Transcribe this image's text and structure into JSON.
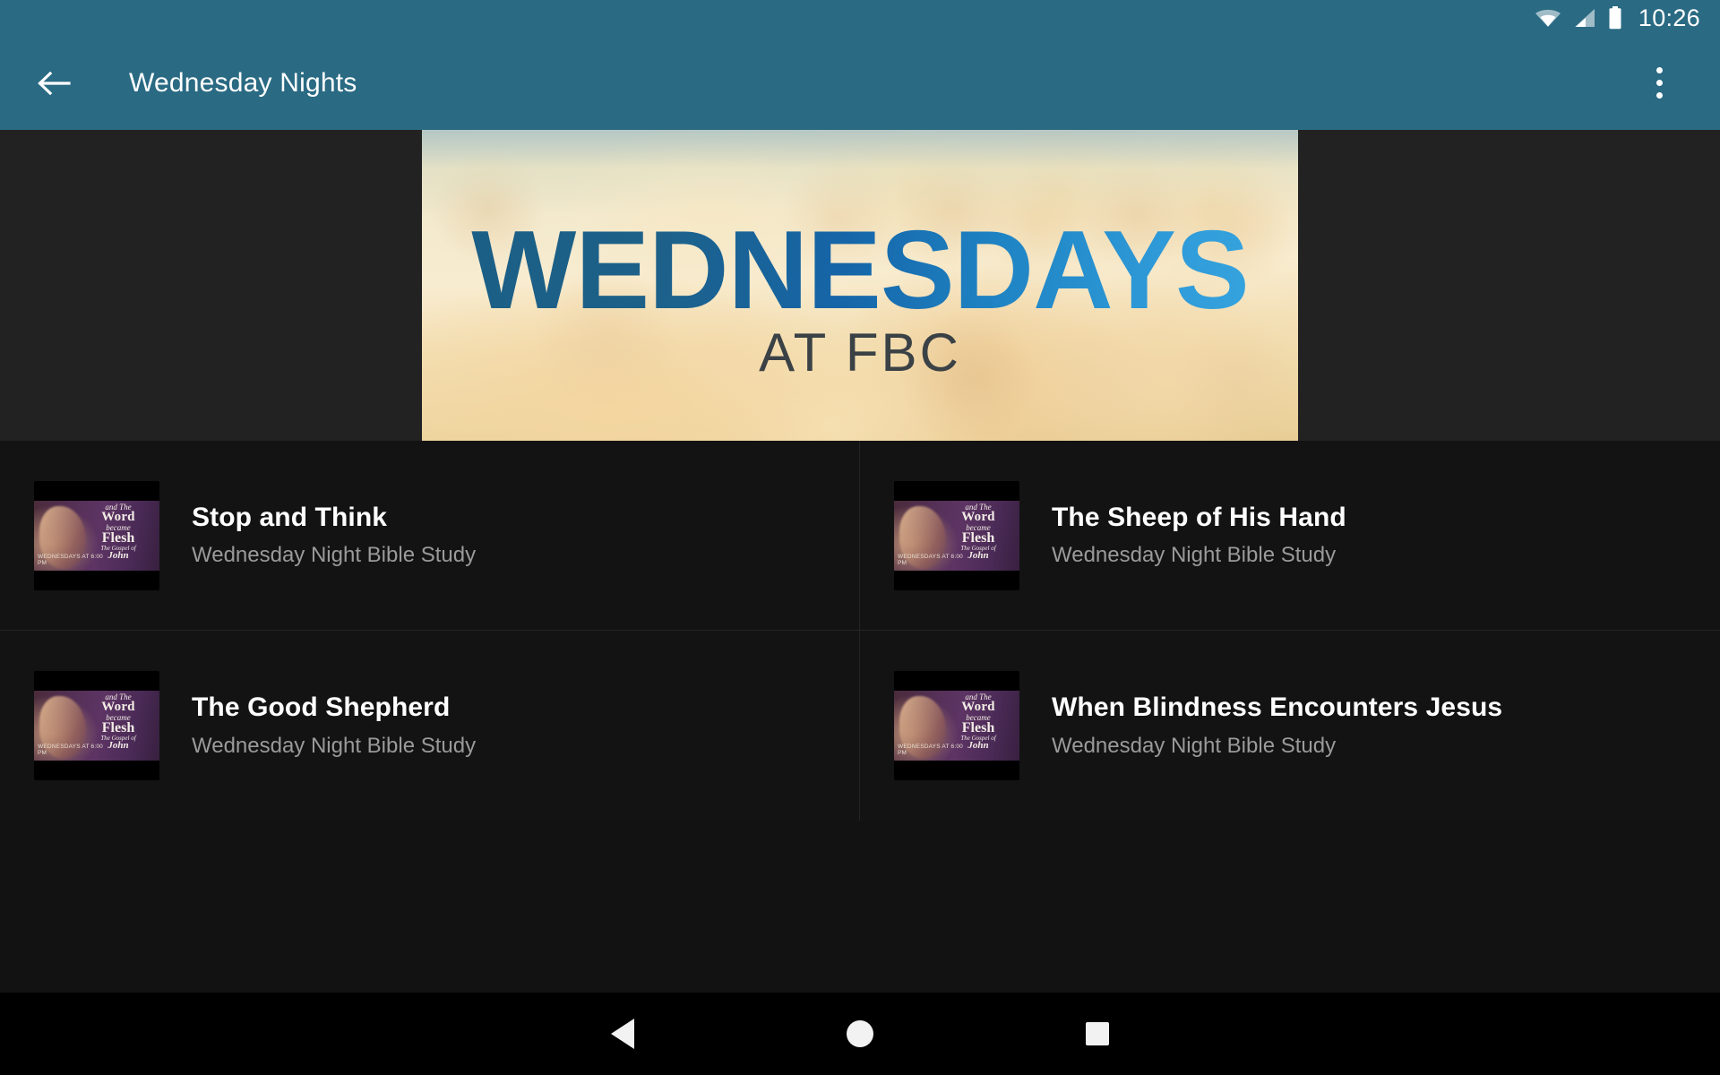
{
  "status_bar": {
    "time": "10:26",
    "icons": [
      "wifi-icon",
      "cell-signal-icon",
      "battery-icon"
    ],
    "background_color": "#2a6a83"
  },
  "app_bar": {
    "back_icon": "arrow-back-icon",
    "title": "Wednesday Nights",
    "overflow_icon": "overflow-menu-icon",
    "background_color": "#2a6a83",
    "text_color": "#ffffff"
  },
  "hero": {
    "title": "WEDNESDAYS",
    "subtitle": "AT FBC",
    "title_gradient_from": "#1b5f86",
    "title_gradient_to": "#35a3de",
    "subtitle_color": "#3b4246",
    "alt": "Wednesdays at FBC banner with smiling people"
  },
  "thumbnail": {
    "line1": "and The",
    "line2": "Word",
    "line3": "became",
    "line4": "Flesh",
    "line5": "The Gospel of",
    "line6": "John",
    "schedule": "WEDNESDAYS AT 6:00 PM"
  },
  "list": {
    "items": [
      {
        "title": "Stop and Think",
        "subtitle": "Wednesday Night Bible Study"
      },
      {
        "title": "The Sheep of His Hand",
        "subtitle": "Wednesday Night Bible Study"
      },
      {
        "title": "The Good Shepherd",
        "subtitle": "Wednesday Night Bible Study"
      },
      {
        "title": "When Blindness Encounters Jesus",
        "subtitle": "Wednesday Night Bible Study"
      }
    ],
    "title_color": "#ffffff",
    "subtitle_color": "#9a9a9a",
    "background_color": "#131313"
  },
  "nav_bar": {
    "back_icon": "nav-back-triangle-icon",
    "home_icon": "nav-home-circle-icon",
    "recents_icon": "nav-recents-square-icon",
    "background_color": "#000000"
  }
}
